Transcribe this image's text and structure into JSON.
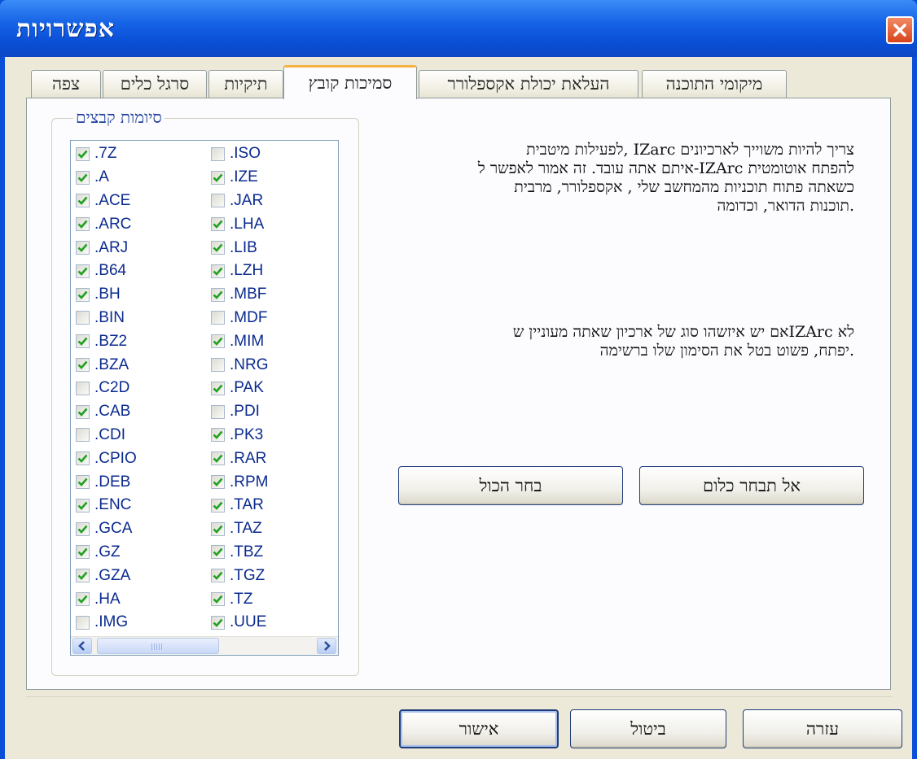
{
  "window": {
    "title": "אפשרויות"
  },
  "tabs": [
    {
      "label": "צפה"
    },
    {
      "label": "סרגל כלים"
    },
    {
      "label": "תיקיות"
    },
    {
      "label": "סמיכות קובץ"
    },
    {
      "label": "העלאת יכולת אקספלורר"
    },
    {
      "label": "מיקומי התוכנה"
    }
  ],
  "active_tab": "סמיכות קובץ",
  "group": {
    "label": "סיומות קבצים"
  },
  "extensions": {
    "left": [
      {
        "ext": ".7Z",
        "checked": true
      },
      {
        "ext": ".A",
        "checked": true
      },
      {
        "ext": ".ACE",
        "checked": true
      },
      {
        "ext": ".ARC",
        "checked": true
      },
      {
        "ext": ".ARJ",
        "checked": true
      },
      {
        "ext": ".B64",
        "checked": true
      },
      {
        "ext": ".BH",
        "checked": true
      },
      {
        "ext": ".BIN",
        "checked": false
      },
      {
        "ext": ".BZ2",
        "checked": true
      },
      {
        "ext": ".BZA",
        "checked": true
      },
      {
        "ext": ".C2D",
        "checked": false
      },
      {
        "ext": ".CAB",
        "checked": true
      },
      {
        "ext": ".CDI",
        "checked": false
      },
      {
        "ext": ".CPIO",
        "checked": true
      },
      {
        "ext": ".DEB",
        "checked": true
      },
      {
        "ext": ".ENC",
        "checked": true
      },
      {
        "ext": ".GCA",
        "checked": true
      },
      {
        "ext": ".GZ",
        "checked": true
      },
      {
        "ext": ".GZA",
        "checked": true
      },
      {
        "ext": ".HA",
        "checked": true
      },
      {
        "ext": ".IMG",
        "checked": false
      }
    ],
    "right": [
      {
        "ext": ".ISO",
        "checked": false
      },
      {
        "ext": ".IZE",
        "checked": true
      },
      {
        "ext": ".JAR",
        "checked": false
      },
      {
        "ext": ".LHA",
        "checked": true
      },
      {
        "ext": ".LIB",
        "checked": true
      },
      {
        "ext": ".LZH",
        "checked": true
      },
      {
        "ext": ".MBF",
        "checked": true
      },
      {
        "ext": ".MDF",
        "checked": false
      },
      {
        "ext": ".MIM",
        "checked": true
      },
      {
        "ext": ".NRG",
        "checked": false
      },
      {
        "ext": ".PAK",
        "checked": true
      },
      {
        "ext": ".PDI",
        "checked": false
      },
      {
        "ext": ".PK3",
        "checked": true
      },
      {
        "ext": ".RAR",
        "checked": true
      },
      {
        "ext": ".RPM",
        "checked": true
      },
      {
        "ext": ".TAR",
        "checked": true
      },
      {
        "ext": ".TAZ",
        "checked": true
      },
      {
        "ext": ".TBZ",
        "checked": true
      },
      {
        "ext": ".TGZ",
        "checked": true
      },
      {
        "ext": ".TZ",
        "checked": true
      },
      {
        "ext": ".UUE",
        "checked": true
      }
    ]
  },
  "description": {
    "para1": [
      "צריך להיות משוייך לארכיונים IZarc ,לפעילות מיטבית",
      "להפתח אוטומטית IZArc-איתם אתה עובד. זה אמור לאפשר ל",
      "כשאתה פתוח תוכניות מהמחשב שלי , אקספלורר, מרבית",
      ".תוכנות הדואר, וכדומה"
    ],
    "para2": [
      "לא IZArcאם יש איזשהו סוג של ארכיון שאתה מעוניין ש",
      ".יפתח, פשוט בטל את הסימון שלו ברשימה"
    ]
  },
  "buttons": {
    "select_none": "אל תבחר כלום",
    "select_all": "בחר הכול",
    "ok": "אישור",
    "cancel": "ביטול",
    "help": "עזרה"
  },
  "colors": {
    "titlebar": "#0a4fd6",
    "dialog_bg": "#ece9d8",
    "check": "#21a121",
    "active_tab_accent": "#f5b343"
  }
}
